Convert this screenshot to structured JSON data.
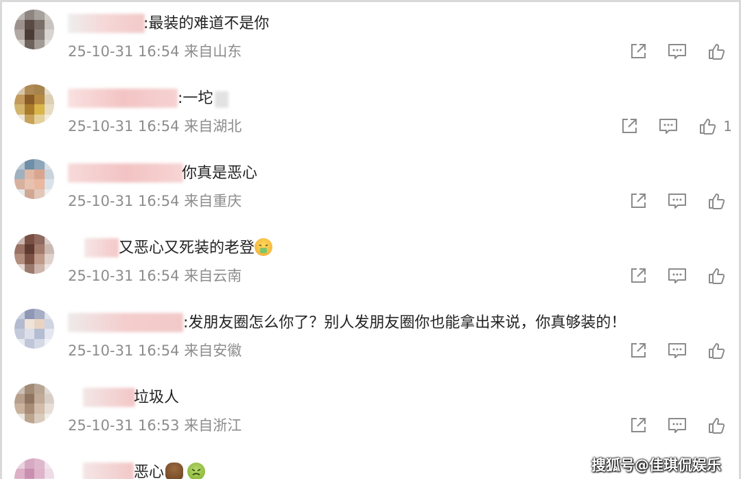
{
  "comments": [
    {
      "text": ":最装的难道不是你",
      "meta": "25-10-31 16:54 来自山东",
      "likes": ""
    },
    {
      "text": ":一坨",
      "meta": "25-10-31 16:54 来自湖北",
      "likes": "1"
    },
    {
      "text": "你真是恶心",
      "meta": "25-10-31 16:54 来自重庆",
      "likes": ""
    },
    {
      "text": "又恶心又死装的老登",
      "meta": "25-10-31 16:54 来自云南",
      "likes": ""
    },
    {
      "text": ":发朋友圈怎么你了？别人发朋友圈你也能拿出来说，你真够装的！",
      "meta": "25-10-31 16:54 来自安徽",
      "likes": ""
    },
    {
      "text": "垃圾人",
      "meta": "25-10-31 16:53 来自浙江",
      "likes": ""
    },
    {
      "text": "恶心",
      "meta": "",
      "likes": ""
    }
  ],
  "icons": {
    "share": "share-icon",
    "comment": "comment-icon",
    "like": "like-icon",
    "emoji_scream": "vomit-face-emoji",
    "emoji_poop": "poop-emoji",
    "emoji_sick": "nauseated-face-emoji"
  },
  "colors": {
    "meta_text": "#8c8c8c",
    "icon": "#888888",
    "name_blur": "#f4c2c2"
  },
  "watermark": "搜狐号@佳琪侃娱乐"
}
